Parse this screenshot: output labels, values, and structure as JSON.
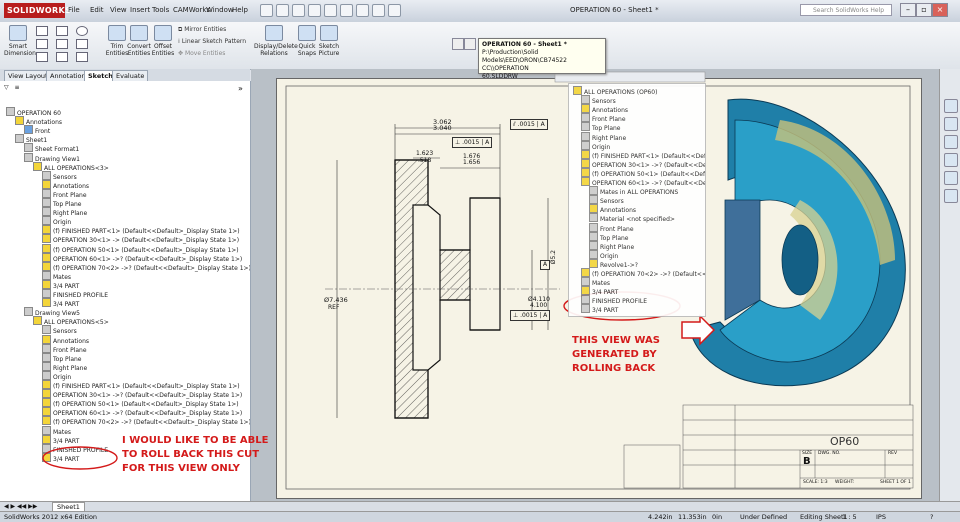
{
  "app": {
    "logo": "SOLIDWORKS",
    "menus": [
      "File",
      "Edit",
      "View",
      "Insert",
      "Tools",
      "CAMWorks",
      "Window",
      "Help"
    ],
    "window_title": "OPERATION 60 - Sheet1 *",
    "search_placeholder": "Search SolidWorks Help"
  },
  "command_manager": {
    "buttons": [
      {
        "label": "Smart Dimension"
      },
      {
        "label": "Trim Entities"
      },
      {
        "label": "Convert Entities"
      },
      {
        "label": "Offset Entities"
      },
      {
        "label": "Display/Delete Relations"
      },
      {
        "label": "Quick Snaps"
      },
      {
        "label": "Sketch Picture"
      }
    ],
    "mirror_entities": "Mirror Entities",
    "linear_pattern": "Linear Sketch Pattern",
    "move_entities": "Move Entities"
  },
  "tooltip": {
    "line1": "OPERATION 60 - Sheet1 *",
    "line2": "P:\\Production\\Solid",
    "line3": "Models\\EED\\ORON\\CB74522 CC\\\\OPERATION",
    "line4": "60.SLDDRW"
  },
  "tabs": [
    "View Layout",
    "Annotation",
    "Sketch",
    "Evaluate"
  ],
  "active_tab": "Sketch",
  "tree": [
    {
      "label": "OPERATION 60",
      "indent": 0,
      "icon": "gray"
    },
    {
      "label": "Annotations",
      "indent": 1,
      "icon": "yel"
    },
    {
      "label": "Front",
      "indent": 2,
      "icon": "blue"
    },
    {
      "label": "Sheet1",
      "indent": 1,
      "icon": "gray"
    },
    {
      "label": "Sheet Format1",
      "indent": 2,
      "icon": "gray"
    },
    {
      "label": "Drawing View1",
      "indent": 2,
      "icon": "gray"
    },
    {
      "label": "ALL OPERATIONS<3>",
      "indent": 3,
      "icon": "yel"
    },
    {
      "label": "Sensors",
      "indent": 4,
      "icon": "gray"
    },
    {
      "label": "Annotations",
      "indent": 4,
      "icon": "yel"
    },
    {
      "label": "Front Plane",
      "indent": 4,
      "icon": "gray"
    },
    {
      "label": "Top Plane",
      "indent": 4,
      "icon": "gray"
    },
    {
      "label": "Right Plane",
      "indent": 4,
      "icon": "gray"
    },
    {
      "label": "Origin",
      "indent": 4,
      "icon": "gray"
    },
    {
      "label": "(f) FINISHED PART<1> (Default<<Default>_Display State 1>)",
      "indent": 4,
      "icon": "yel"
    },
    {
      "label": "OPERATION 30<1> -> (Default<<Default>_Display State 1>)",
      "indent": 4,
      "icon": "yel"
    },
    {
      "label": "(f) OPERATION 50<1> (Default<<Default>_Display State 1>)",
      "indent": 4,
      "icon": "yel"
    },
    {
      "label": "OPERATION 60<1> ->? (Default<<Default>_Display State 1>)",
      "indent": 4,
      "icon": "yel"
    },
    {
      "label": "(f) OPERATION 70<2> ->? (Default<<Default>_Display State 1>)",
      "indent": 4,
      "icon": "yel"
    },
    {
      "label": "Mates",
      "indent": 4,
      "icon": "gray"
    },
    {
      "label": "3/4 PART",
      "indent": 4,
      "icon": "yel"
    },
    {
      "label": "FINISHED PROFILE",
      "indent": 4,
      "icon": "gray"
    },
    {
      "label": "3/4 PART",
      "indent": 4,
      "icon": "yel"
    },
    {
      "label": "Drawing View5",
      "indent": 2,
      "icon": "gray"
    },
    {
      "label": "ALL OPERATIONS<5>",
      "indent": 3,
      "icon": "yel"
    },
    {
      "label": "Sensors",
      "indent": 4,
      "icon": "gray"
    },
    {
      "label": "Annotations",
      "indent": 4,
      "icon": "yel"
    },
    {
      "label": "Front Plane",
      "indent": 4,
      "icon": "gray"
    },
    {
      "label": "Top Plane",
      "indent": 4,
      "icon": "gray"
    },
    {
      "label": "Right Plane",
      "indent": 4,
      "icon": "gray"
    },
    {
      "label": "Origin",
      "indent": 4,
      "icon": "gray"
    },
    {
      "label": "(f) FINISHED PART<1> (Default<<Default>_Display State 1>)",
      "indent": 4,
      "icon": "yel"
    },
    {
      "label": "OPERATION 30<1> ->? (Default<<Default>_Display State 1>)",
      "indent": 4,
      "icon": "yel"
    },
    {
      "label": "(f) OPERATION 50<1> (Default<<Default>_Display State 1>)",
      "indent": 4,
      "icon": "yel"
    },
    {
      "label": "OPERATION 60<1> ->? (Default<<Default>_Display State 1>)",
      "indent": 4,
      "icon": "yel"
    },
    {
      "label": "(f) OPERATION 70<2> ->? (Default<<Default>_Display State 1>)",
      "indent": 4,
      "icon": "yel"
    },
    {
      "label": "Mates",
      "indent": 4,
      "icon": "gray"
    },
    {
      "label": "3/4 PART",
      "indent": 4,
      "icon": "yel"
    },
    {
      "label": "FINISHED PROFILE",
      "indent": 4,
      "icon": "gray"
    },
    {
      "label": "3/4 PART",
      "indent": 4,
      "icon": "yel"
    }
  ],
  "overlay_tree": [
    {
      "label": "ALL OPERATIONS (OP60)",
      "indent": 0,
      "icon": "yel"
    },
    {
      "label": "Sensors",
      "indent": 1,
      "icon": "gray"
    },
    {
      "label": "Annotations",
      "indent": 1,
      "icon": "yel"
    },
    {
      "label": "Front Plane",
      "indent": 1,
      "icon": "gray"
    },
    {
      "label": "Top Plane",
      "indent": 1,
      "icon": "gray"
    },
    {
      "label": "Right Plane",
      "indent": 1,
      "icon": "gray"
    },
    {
      "label": "Origin",
      "indent": 1,
      "icon": "gray"
    },
    {
      "label": "(f) FINISHED PART<1> (Default<<Default",
      "indent": 1,
      "icon": "yel"
    },
    {
      "label": "OPERATION 30<1> ->? (Default<<Default",
      "indent": 1,
      "icon": "yel"
    },
    {
      "label": "(f) OPERATION 50<1> (Default<<Default",
      "indent": 1,
      "icon": "yel"
    },
    {
      "label": "OPERATION 60<1> ->? (Default<<Default",
      "indent": 1,
      "icon": "yel"
    },
    {
      "label": "Mates in ALL OPERATIONS",
      "indent": 2,
      "icon": "gray"
    },
    {
      "label": "Sensors",
      "indent": 2,
      "icon": "gray"
    },
    {
      "label": "Annotations",
      "indent": 2,
      "icon": "yel"
    },
    {
      "label": "Material <not specified>",
      "indent": 2,
      "icon": "gray"
    },
    {
      "label": "Front Plane",
      "indent": 2,
      "icon": "gray"
    },
    {
      "label": "Top Plane",
      "indent": 2,
      "icon": "gray"
    },
    {
      "label": "Right Plane",
      "indent": 2,
      "icon": "gray"
    },
    {
      "label": "Origin",
      "indent": 2,
      "icon": "gray"
    },
    {
      "label": "Revolve1->?",
      "indent": 2,
      "icon": "yel"
    },
    {
      "label": "(f) OPERATION 70<2> ->? (Default<<Default",
      "indent": 1,
      "icon": "yel"
    },
    {
      "label": "Mates",
      "indent": 1,
      "icon": "gray"
    },
    {
      "label": "3/4 PART",
      "indent": 1,
      "icon": "yel"
    },
    {
      "label": "FINISHED PROFILE",
      "indent": 1,
      "icon": "gray"
    },
    {
      "label": "3/4 PART",
      "indent": 1,
      "icon": "gray"
    }
  ],
  "dimensions": {
    "d1": "3.062",
    "d2": "3.040",
    "d3": "1.623",
    "d4": ".518",
    "d5": "1.676",
    "d6": "1.656",
    "d7": "Ø7.436",
    "d8": "REF",
    "d9": "Ø4.110",
    "d10": "4.100",
    "d11": "Ø5.2",
    "tol1": ".0015",
    "tol1_ref": "A",
    "tol2": ".0015",
    "tol2_ref": "A",
    "tol3": ".0015",
    "tol3_ref": "A",
    "datum": "A"
  },
  "title_block": {
    "title": "OP60",
    "size_label": "SIZE",
    "size_value": "B",
    "dwg_no_label": "DWG. NO.",
    "rev_label": "REV",
    "scale_label": "SCALE: 1:3",
    "weight_label": "WEIGHT:",
    "sheet_label": "SHEET 1 OF 1"
  },
  "annotations": {
    "right_text": [
      "THIS VIEW WAS",
      "GENERATED BY",
      "ROLLING BACK"
    ],
    "left_text": [
      "I WOULD LIKE TO BE ABLE",
      "TO ROLL BACK THIS CUT",
      "FOR THIS VIEW ONLY"
    ],
    "color": "#d41a1a"
  },
  "sheet_tab": "Sheet1",
  "status": {
    "app": "SolidWorks 2012 x64 Edition",
    "x": "4.242in",
    "y": "11.353in",
    "z": "0in",
    "state": "Under Defined",
    "editing": "Editing Sheet1",
    "scale": "1 : 5",
    "units": "IPS"
  }
}
